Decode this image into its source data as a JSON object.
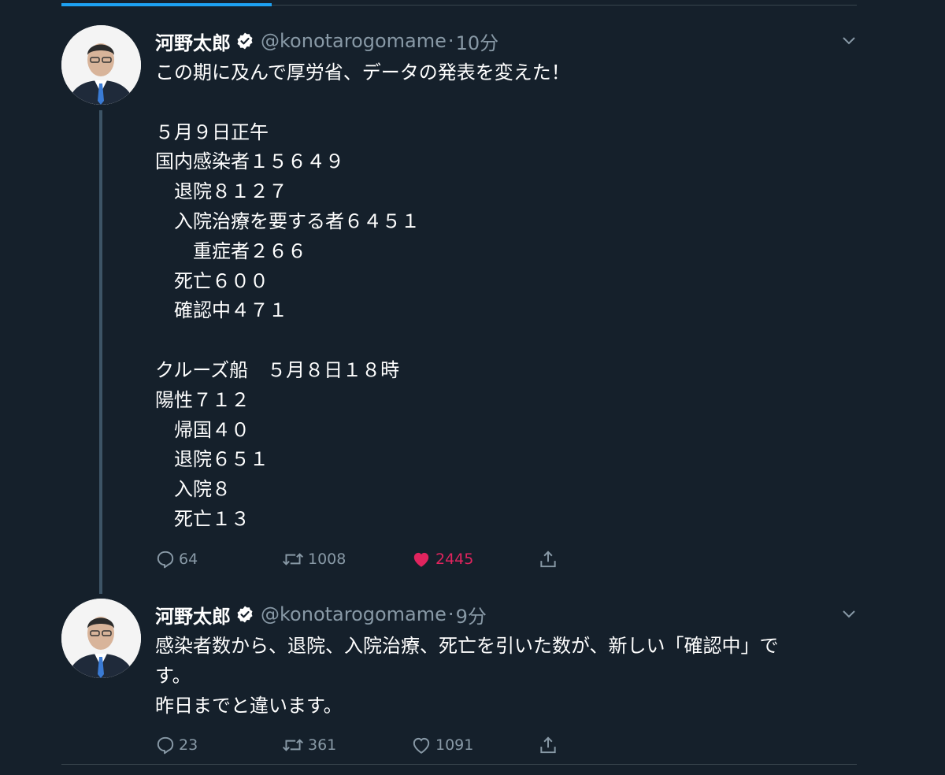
{
  "colors": {
    "background": "#15202b",
    "text_primary": "#ffffff",
    "text_secondary": "#8899a6",
    "verified_badge": "#ffffff",
    "like_active": "#e0245e",
    "thread_line": "#3d5466",
    "tab_indicator": "#1da1f2"
  },
  "tweets": [
    {
      "display_name": "河野太郎",
      "handle": "@konotarogomame",
      "separator": "·",
      "time": "10分",
      "text": "この期に及んで厚労省、データの発表を変えた！\n\n５月９日正午\n国内感染者１５６４９\n　退院８１２７\n　入院治療を要する者６４５１\n　　重症者２６６\n　死亡６００\n　確認中４７１\n\nクルーズ船　５月８日１８時\n陽性７１２\n　帰国４０\n　退院６５１\n　入院８\n　死亡１３",
      "replies": "64",
      "retweets": "1008",
      "likes": "2445",
      "liked": true
    },
    {
      "display_name": "河野太郎",
      "handle": "@konotarogomame",
      "separator": "·",
      "time": "9分",
      "text": "感染者数から、退院、入院治療、死亡を引いた数が、新しい「確認中」で\nす。\n昨日までと違います。",
      "replies": "23",
      "retweets": "361",
      "likes": "1091",
      "liked": false
    }
  ],
  "icons": {
    "verified": "verified-badge-icon",
    "caret": "chevron-down-icon",
    "reply": "reply-icon",
    "retweet": "retweet-icon",
    "like": "heart-icon",
    "share": "share-icon"
  }
}
